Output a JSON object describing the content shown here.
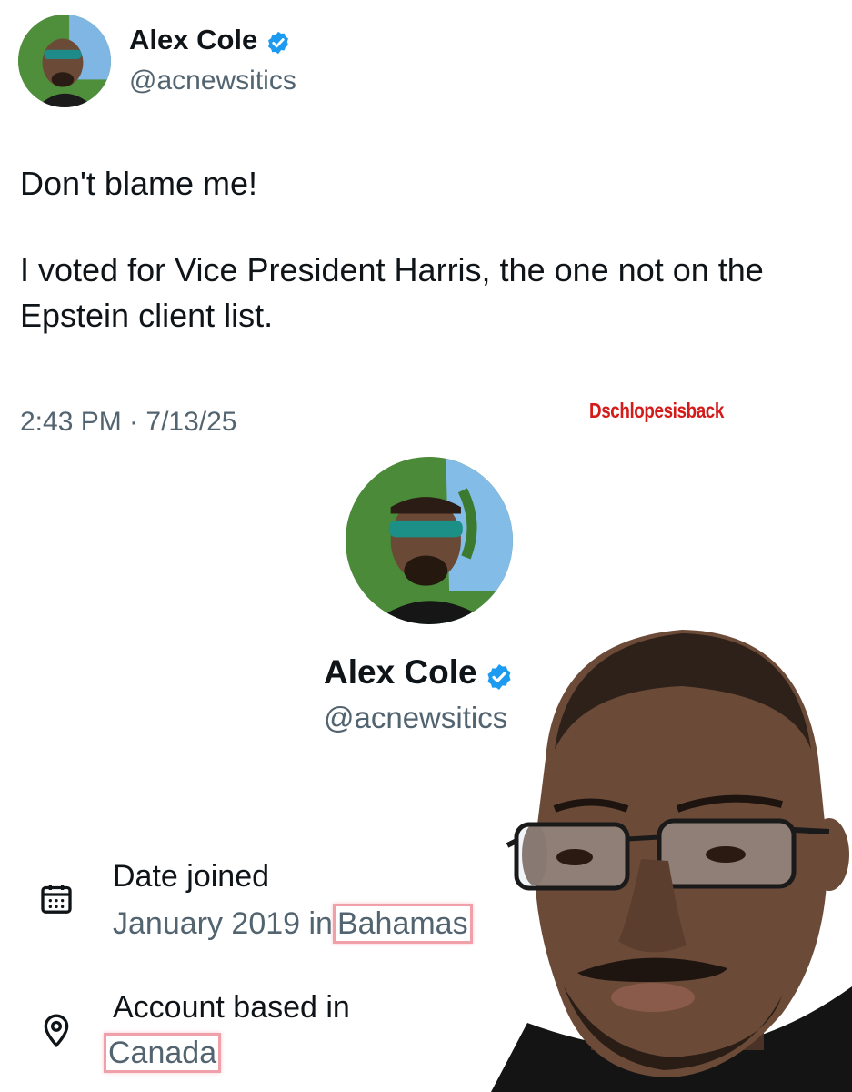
{
  "tweet": {
    "author": {
      "display_name": "Alex Cole",
      "handle": "@acnewsitics",
      "verified": true
    },
    "text_line1": "Don't blame me!",
    "text_line2": "I voted for Vice President Harris, the one not on the Epstein client list.",
    "timestamp": "2:43 PM · 7/13/25"
  },
  "watermark": "Dschlopesisback",
  "profile": {
    "display_name": "Alex Cole",
    "handle": "@acnewsitics",
    "verified": true,
    "date_joined": {
      "label": "Date joined",
      "value_prefix": "January 2019 in",
      "value_highlight": "Bahamas",
      "icon": "calendar-icon"
    },
    "account_based": {
      "label": "Account based in",
      "value_highlight": "Canada",
      "icon": "location-pin-icon"
    }
  },
  "colors": {
    "verified_blue": "#1d9bf0",
    "watermark_red": "#d51a1a",
    "highlight_pink": "#f0a0a8",
    "secondary_text": "#536471"
  }
}
